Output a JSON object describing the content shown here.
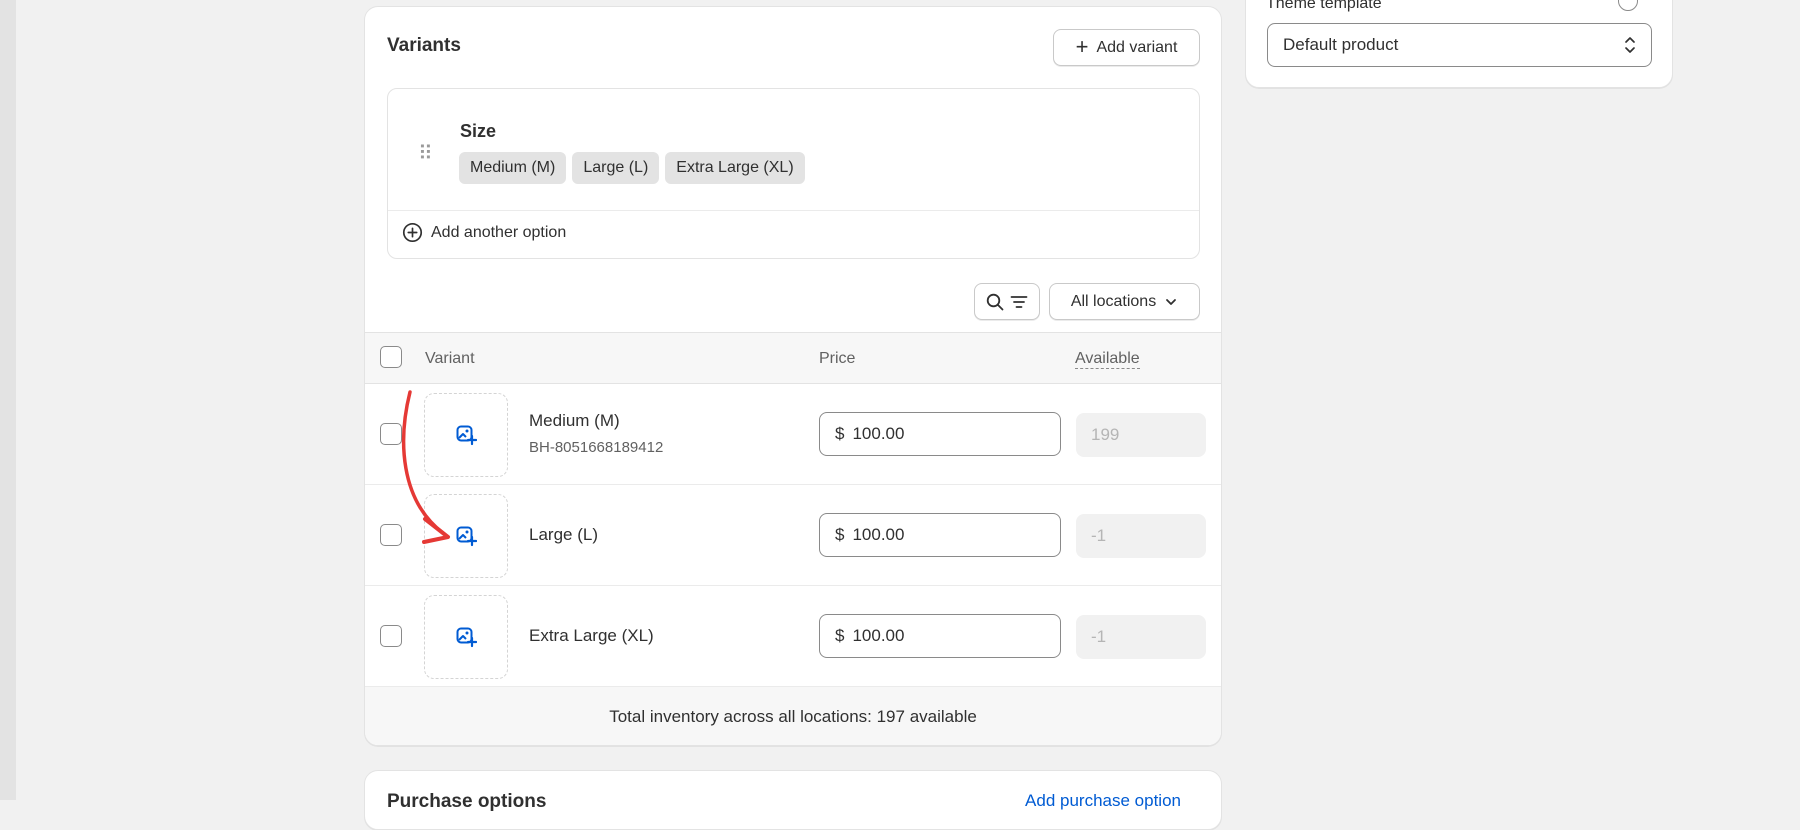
{
  "variants_card": {
    "title": "Variants",
    "add_variant_label": "Add variant",
    "option": {
      "name": "Size",
      "values": [
        "Medium (M)",
        "Large (L)",
        "Extra Large (XL)"
      ],
      "add_another_label": "Add another option"
    },
    "locations_label": "All locations",
    "table": {
      "headers": {
        "variant": "Variant",
        "price": "Price",
        "available": "Available"
      },
      "rows": [
        {
          "name": "Medium (M)",
          "sku": "BH-8051668189412",
          "currency": "$",
          "price": "100.00",
          "available": "199"
        },
        {
          "name": "Large (L)",
          "sku": "",
          "currency": "$",
          "price": "100.00",
          "available": "-1"
        },
        {
          "name": "Extra Large (XL)",
          "sku": "",
          "currency": "$",
          "price": "100.00",
          "available": "-1"
        }
      ]
    },
    "footer": "Total inventory across all locations: 197 available"
  },
  "theme_card": {
    "label": "Theme template",
    "select_value": "Default product"
  },
  "bottom_card": {
    "title": "Purchase options",
    "link": "Add purchase option"
  },
  "icons": {
    "add": "plus-icon",
    "drag": "drag-handle-icon",
    "add_option": "circle-plus-icon",
    "search": "search-icon",
    "filter": "filter-icon",
    "chevron": "chevron-down-icon",
    "image_add": "image-add-icon",
    "select": "select-arrows-icon",
    "info": "info-icon"
  },
  "colors": {
    "accent_blue": "#005bd3",
    "annotation_red": "#e53935",
    "page_bg": "#f1f1f1"
  }
}
